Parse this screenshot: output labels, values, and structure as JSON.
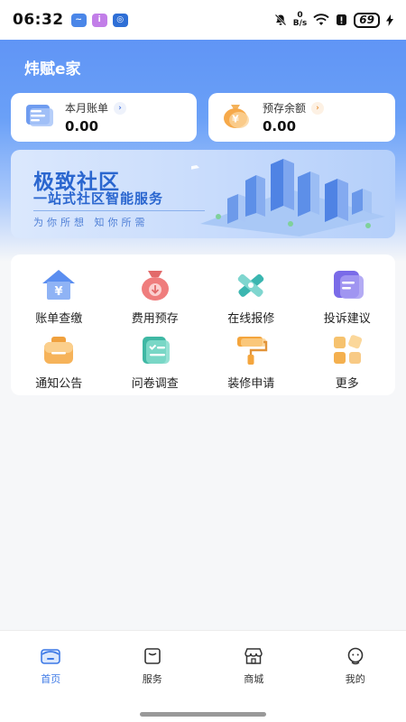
{
  "status_bar": {
    "time": "06:32",
    "battery": "69",
    "net_speed_top": "0",
    "net_speed_bottom": "B/s",
    "icons": [
      "app-notification-icon-1",
      "app-notification-icon-2",
      "app-notification-icon-3",
      "mute-bell-icon",
      "wifi-icon",
      "alert-icon",
      "battery-icon",
      "charging-icon"
    ]
  },
  "app": {
    "title": "炜赋e家"
  },
  "cards": [
    {
      "label": "本月账单",
      "value": "0.00",
      "icon": "bill-icon"
    },
    {
      "label": "预存余额",
      "value": "0.00",
      "icon": "money-bag-icon"
    }
  ],
  "banner": {
    "title": "极致社区",
    "subtitle": "一站式社区智能服务",
    "slogan": "为你所想  知你所需"
  },
  "services": [
    {
      "label": "账单查缴",
      "icon": "house-yen-icon"
    },
    {
      "label": "费用预存",
      "icon": "money-bag-icon"
    },
    {
      "label": "在线报修",
      "icon": "tools-icon"
    },
    {
      "label": "投诉建议",
      "icon": "feedback-icon"
    },
    {
      "label": "通知公告",
      "icon": "notice-icon"
    },
    {
      "label": "问卷调查",
      "icon": "survey-icon"
    },
    {
      "label": "装修申请",
      "icon": "paint-roller-icon"
    },
    {
      "label": "更多",
      "icon": "more-grid-icon"
    }
  ],
  "tabs": [
    {
      "label": "首页",
      "icon": "home-icon",
      "active": true
    },
    {
      "label": "服务",
      "icon": "service-icon",
      "active": false
    },
    {
      "label": "商城",
      "icon": "shop-icon",
      "active": false
    },
    {
      "label": "我的",
      "icon": "profile-icon",
      "active": false
    }
  ],
  "colors": {
    "brand": "#3d79e6",
    "hero_top": "#5b8ff5",
    "banner_text": "#2a66cf"
  }
}
